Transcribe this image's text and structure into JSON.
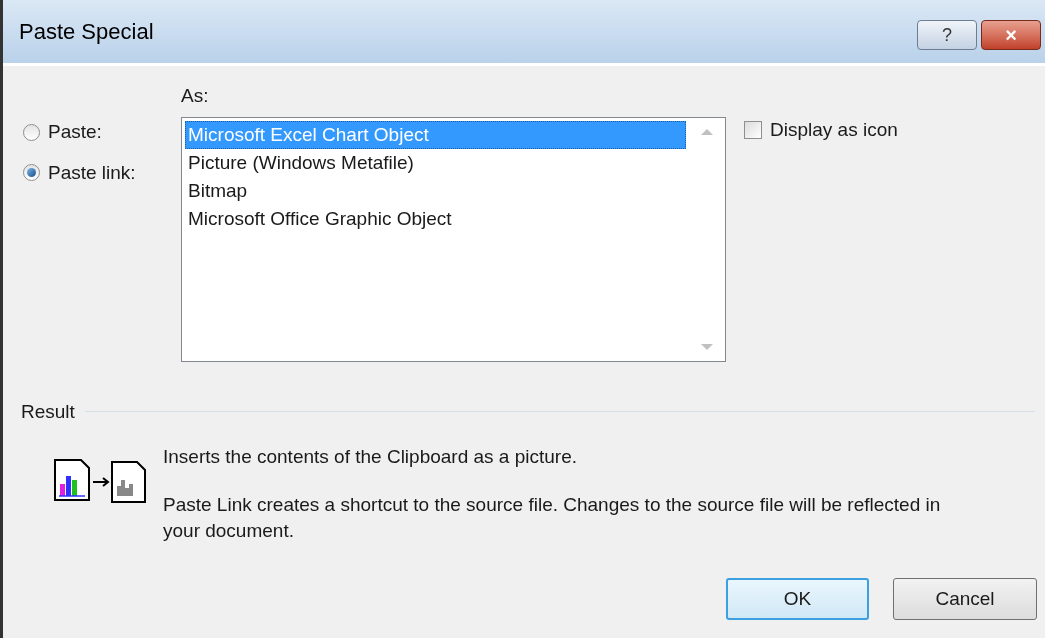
{
  "window": {
    "title": "Paste Special",
    "buttons": [
      {
        "kind": "help",
        "label": "?"
      },
      {
        "kind": "close",
        "label": "×"
      }
    ]
  },
  "paste_options": [
    {
      "label": "Paste:",
      "selected": false
    },
    {
      "label": "Paste link:",
      "selected": true
    }
  ],
  "as_label": "As:",
  "formats": [
    {
      "label": "Microsoft Excel Chart Object",
      "selected": true
    },
    {
      "label": "Picture (Windows Metafile)",
      "selected": false
    },
    {
      "label": "Bitmap",
      "selected": false
    },
    {
      "label": "Microsoft Office Graphic Object",
      "selected": false
    }
  ],
  "display_as_icon": {
    "label": "Display as icon",
    "checked": false
  },
  "result": {
    "title": "Result",
    "paragraphs": [
      "Inserts the contents of the Clipboard as a picture.",
      "Paste Link creates a shortcut to the source file. Changes to the source file will be reflected in your document."
    ]
  },
  "buttons": [
    {
      "label": "OK",
      "default": true
    },
    {
      "label": "Cancel",
      "default": false
    }
  ]
}
